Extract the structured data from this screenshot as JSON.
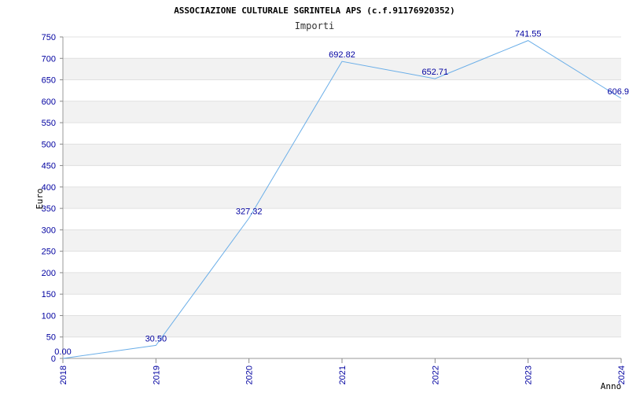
{
  "chart_data": {
    "type": "line",
    "title": "ASSOCIAZIONE CULTURALE SGRINTELA APS (c.f.91176920352)",
    "subtitle": "Importi",
    "xlabel": "Anno",
    "ylabel": "Euro",
    "x": [
      "2018",
      "2019",
      "2020",
      "2021",
      "2022",
      "2023",
      "2024"
    ],
    "values": [
      0.0,
      30.5,
      327.32,
      692.82,
      652.71,
      741.55,
      606.9
    ],
    "data_labels": [
      "0.00",
      "30.50",
      "327.32",
      "692.82",
      "652.71",
      "741.55",
      "606.9"
    ],
    "ylim": [
      0,
      750
    ],
    "yticks": [
      "0",
      "50",
      "100",
      "150",
      "200",
      "250",
      "300",
      "350",
      "400",
      "450",
      "500",
      "550",
      "600",
      "650",
      "700",
      "750"
    ],
    "grid": "horizontal alternating bands",
    "line_color": "#6aaee8",
    "band_color": "#f2f2f2",
    "tick_color": "#0000a0"
  }
}
